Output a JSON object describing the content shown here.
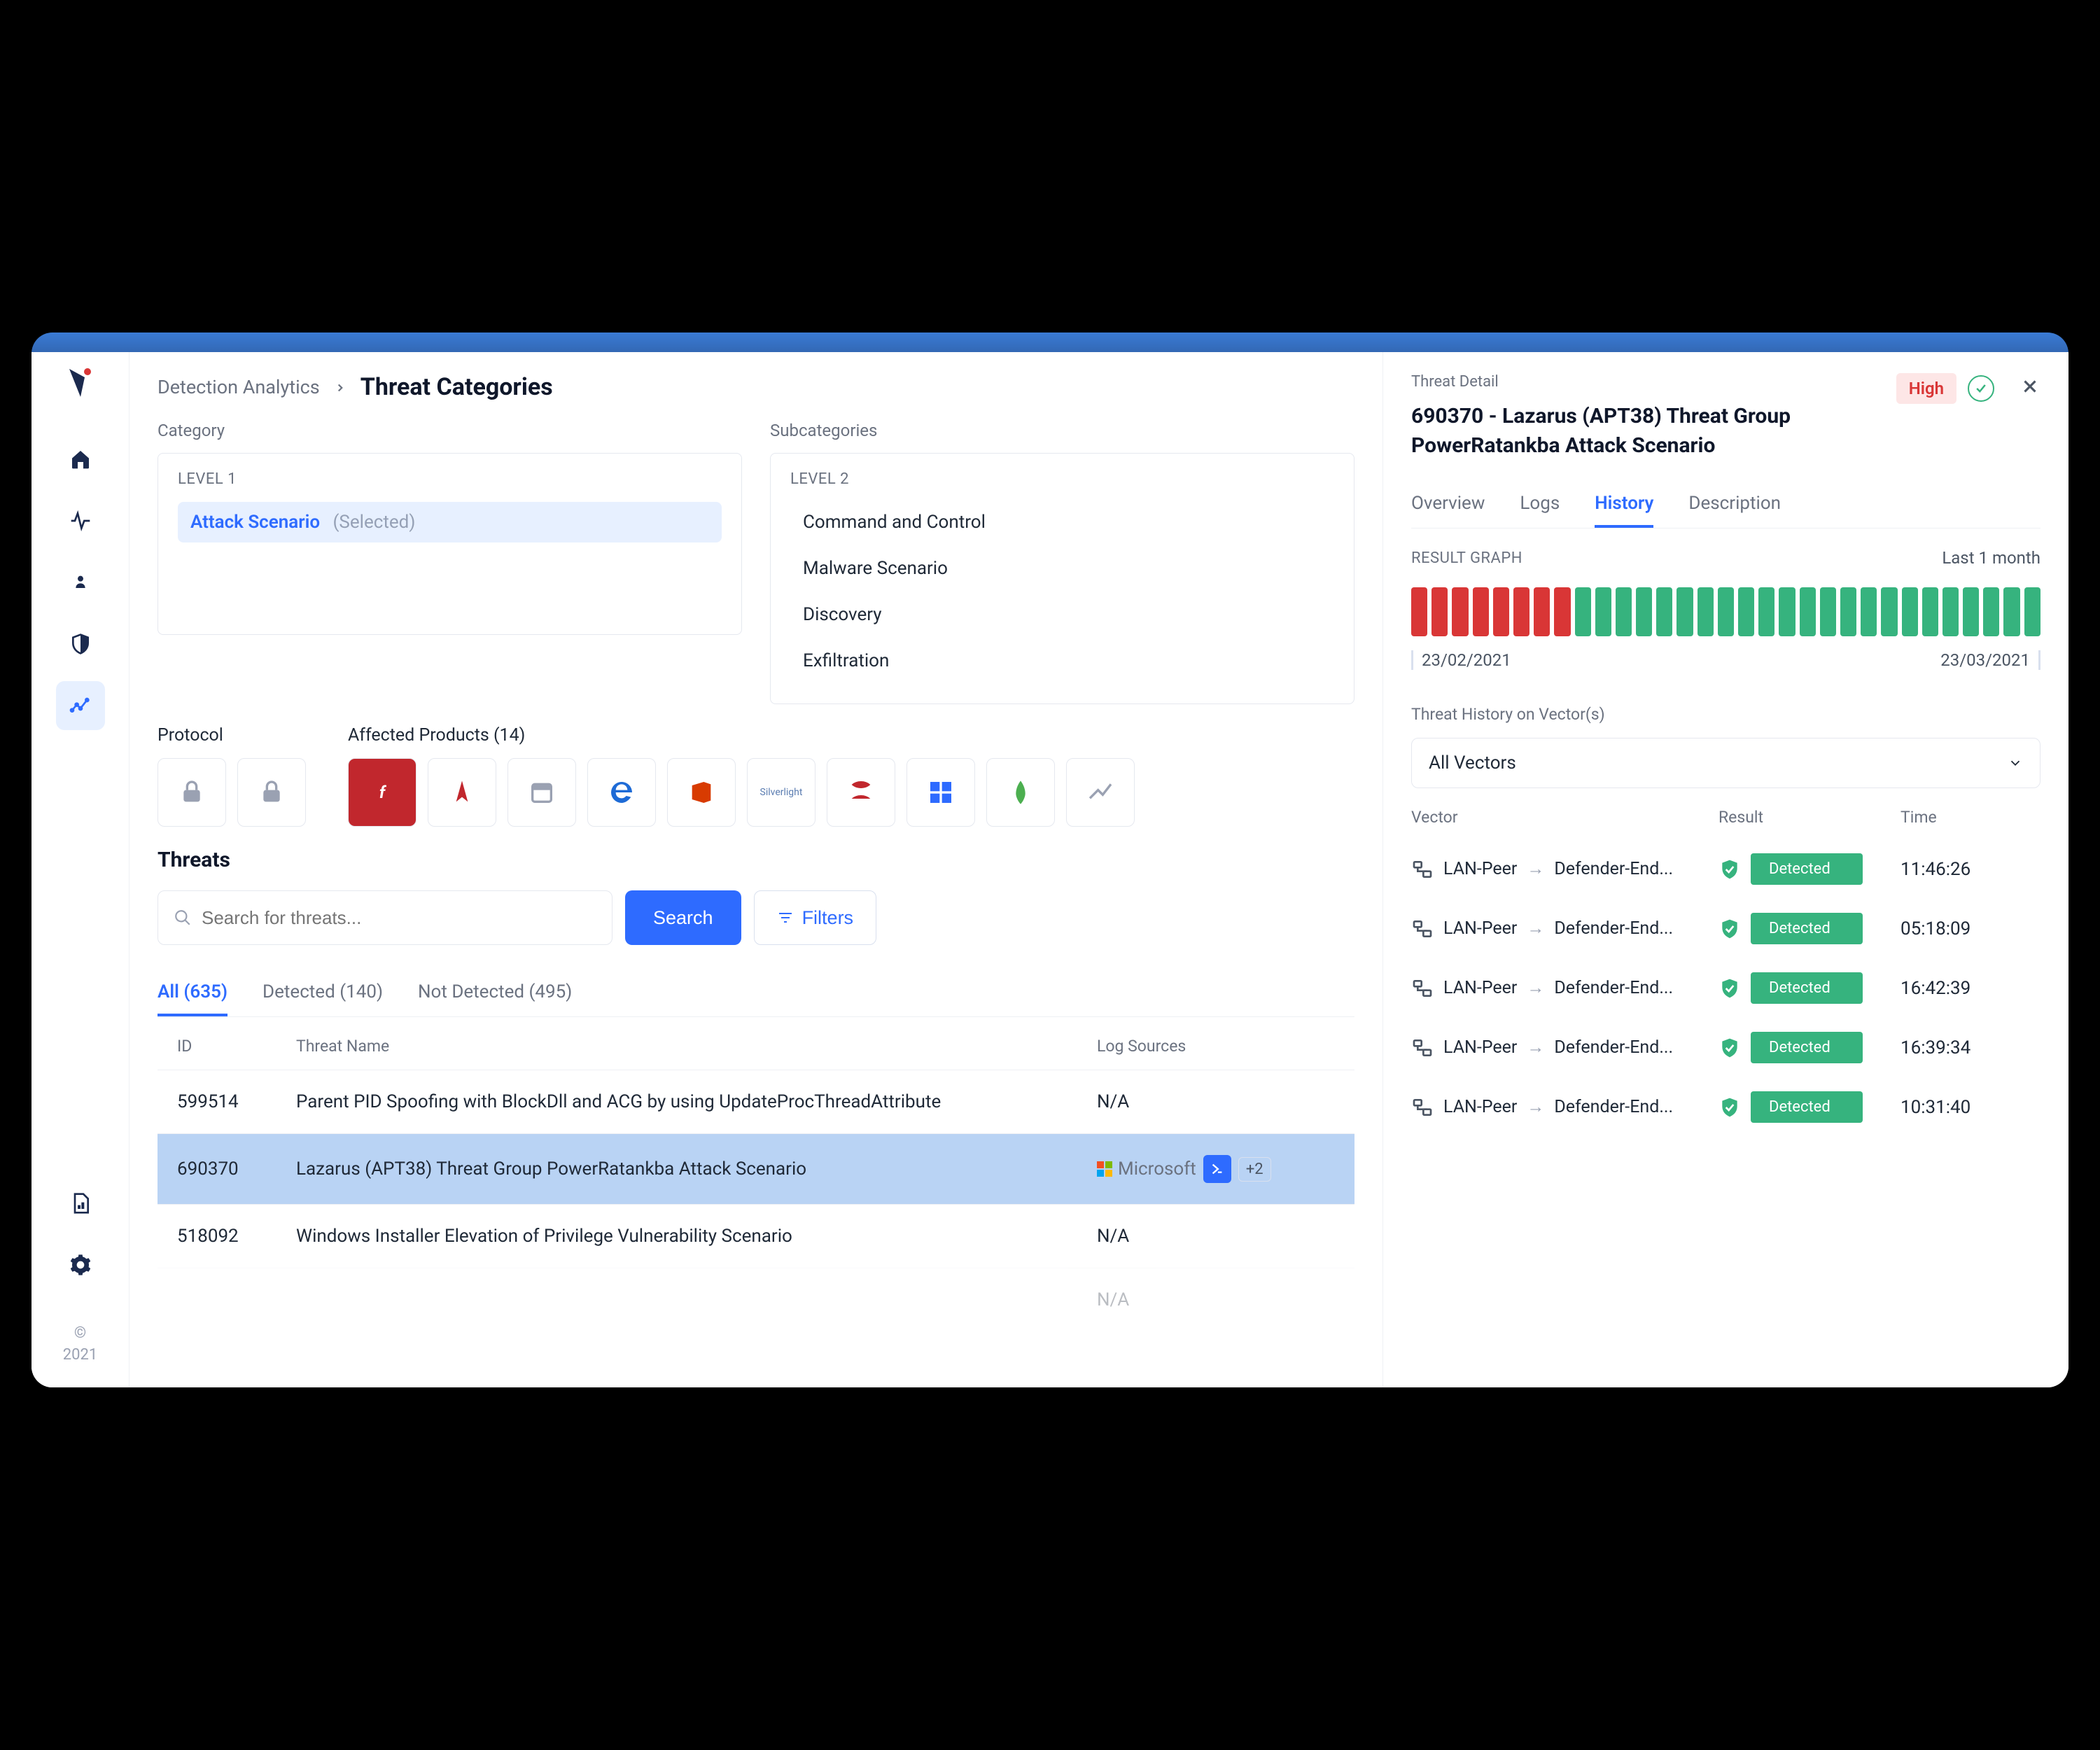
{
  "copyright": {
    "symbol": "©",
    "year": "2021"
  },
  "breadcrumb": {
    "parent": "Detection Analytics",
    "current": "Threat Categories"
  },
  "categories": {
    "label": "Category",
    "level1_label": "LEVEL 1",
    "level1": {
      "name": "Attack Scenario",
      "tag": "(Selected)"
    },
    "sub_label": "Subcategories",
    "level2_label": "LEVEL 2",
    "level2": [
      "Command and Control",
      "Malware Scenario",
      "Discovery",
      "Exfiltration"
    ]
  },
  "protocol_label": "Protocol",
  "affected_label": "Affected Products (14)",
  "threats": {
    "title": "Threats",
    "search_placeholder": "Search for threats...",
    "search_btn": "Search",
    "filters_btn": "Filters",
    "tabs": [
      "All (635)",
      "Detected (140)",
      "Not Detected (495)"
    ],
    "head": {
      "id": "ID",
      "name": "Threat Name",
      "src": "Log Sources"
    },
    "rows": [
      {
        "id": "599514",
        "name": "Parent PID Spoofing with BlockDll and ACG by using UpdateProcThreadAttribute",
        "src": "N/A"
      },
      {
        "id": "690370",
        "name": "Lazarus (APT38) Threat Group PowerRatankba Attack Scenario",
        "src_type": "ms",
        "ms_label": "Microsoft",
        "plus": "+2"
      },
      {
        "id": "518092",
        "name": "Windows Installer Elevation of Privilege Vulnerability Scenario",
        "src": "N/A"
      },
      {
        "id": "",
        "name": "",
        "src": "N/A"
      }
    ]
  },
  "detail": {
    "label": "Threat Detail",
    "title": "690370 - Lazarus (APT38) Threat Group PowerRatankba Attack Scenario",
    "badge": "High",
    "tabs": [
      "Overview",
      "Logs",
      "History",
      "Description"
    ],
    "graph_label": "RESULT GRAPH",
    "graph_range": "Last 1 month",
    "bars": [
      "red",
      "red",
      "red",
      "red",
      "red",
      "red",
      "red",
      "red",
      "green",
      "green",
      "green",
      "green",
      "green",
      "green",
      "green",
      "green",
      "green",
      "green",
      "green",
      "green",
      "green",
      "green",
      "green",
      "green",
      "green",
      "green",
      "green",
      "green",
      "green",
      "green",
      "green"
    ],
    "date_start": "23/02/2021",
    "date_end": "23/03/2021",
    "vectors_label": "Threat History on Vector(s)",
    "vectors_select": "All Vectors",
    "hist_head": {
      "vec": "Vector",
      "res": "Result",
      "time": "Time"
    },
    "detected_label": "Detected",
    "from_label": "LAN-Peer",
    "to_label": "Defender-End...",
    "rows": [
      {
        "time": "11:46:26"
      },
      {
        "time": "05:18:09"
      },
      {
        "time": "16:42:39"
      },
      {
        "time": "16:39:34"
      },
      {
        "time": "10:31:40"
      }
    ]
  }
}
